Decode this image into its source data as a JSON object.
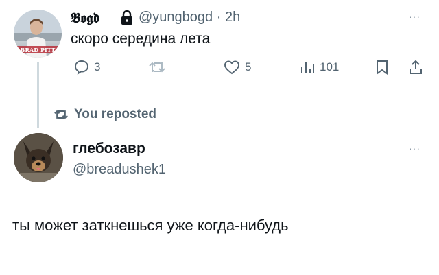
{
  "tweet": {
    "author_name": "𝕭𝖔𝖌𝖉",
    "author_handle": "@yungbogd",
    "time": "· 2h",
    "text": "скоро середина лета",
    "replies": "3",
    "likes": "5",
    "views": "101",
    "avatar_caption": "BRAD PITT"
  },
  "repost_label": "You reposted",
  "reply": {
    "author_name": "глебозавр",
    "author_handle": "@breadushek1",
    "text": "ты может заткнешься уже когда-нибудь"
  },
  "more_glyph": "···",
  "icons": [
    "lock-icon",
    "reply-icon",
    "repost-icon",
    "like-icon",
    "views-icon",
    "bookmark-icon",
    "share-icon",
    "more-icon"
  ]
}
